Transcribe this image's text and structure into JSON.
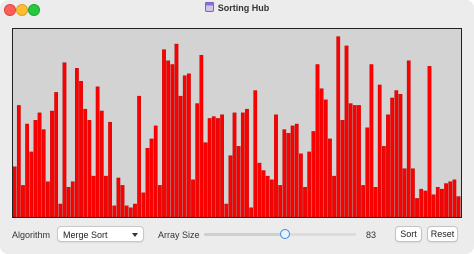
{
  "window": {
    "title": "Sorting Hub"
  },
  "bars": {
    "color": "#ff0000",
    "edge_color": "#b30000",
    "background": "#d3d3d3",
    "max_value": 100,
    "values": [
      27,
      60,
      17,
      50,
      35,
      52,
      56,
      47,
      19,
      57,
      67,
      7,
      83,
      16,
      19,
      80,
      73,
      58,
      52,
      22,
      70,
      57,
      22,
      51,
      6,
      21,
      17,
      6,
      5,
      7,
      65,
      13,
      37,
      42,
      49,
      17,
      90,
      84,
      82,
      93,
      65,
      76,
      77,
      20,
      61,
      87,
      40,
      53,
      54,
      53,
      55,
      7,
      33,
      56,
      38,
      56,
      58,
      5,
      68,
      29,
      25,
      22,
      20,
      55,
      17,
      47,
      45,
      49,
      50,
      34,
      16,
      35,
      46,
      82,
      69,
      63,
      42,
      22,
      97,
      52,
      92,
      61,
      60,
      60,
      17,
      48,
      82,
      16,
      71,
      38,
      55,
      64,
      68,
      66,
      26,
      84,
      26,
      10,
      15,
      14,
      81,
      12,
      16,
      15,
      18,
      19,
      20,
      11
    ]
  },
  "controls": {
    "algorithm_label": "Algorithm",
    "algorithm_value": "Merge Sort",
    "array_size_label": "Array Size",
    "array_size_value": "83",
    "array_size_fraction": 0.53,
    "sort_label": "Sort",
    "reset_label": "Reset"
  }
}
